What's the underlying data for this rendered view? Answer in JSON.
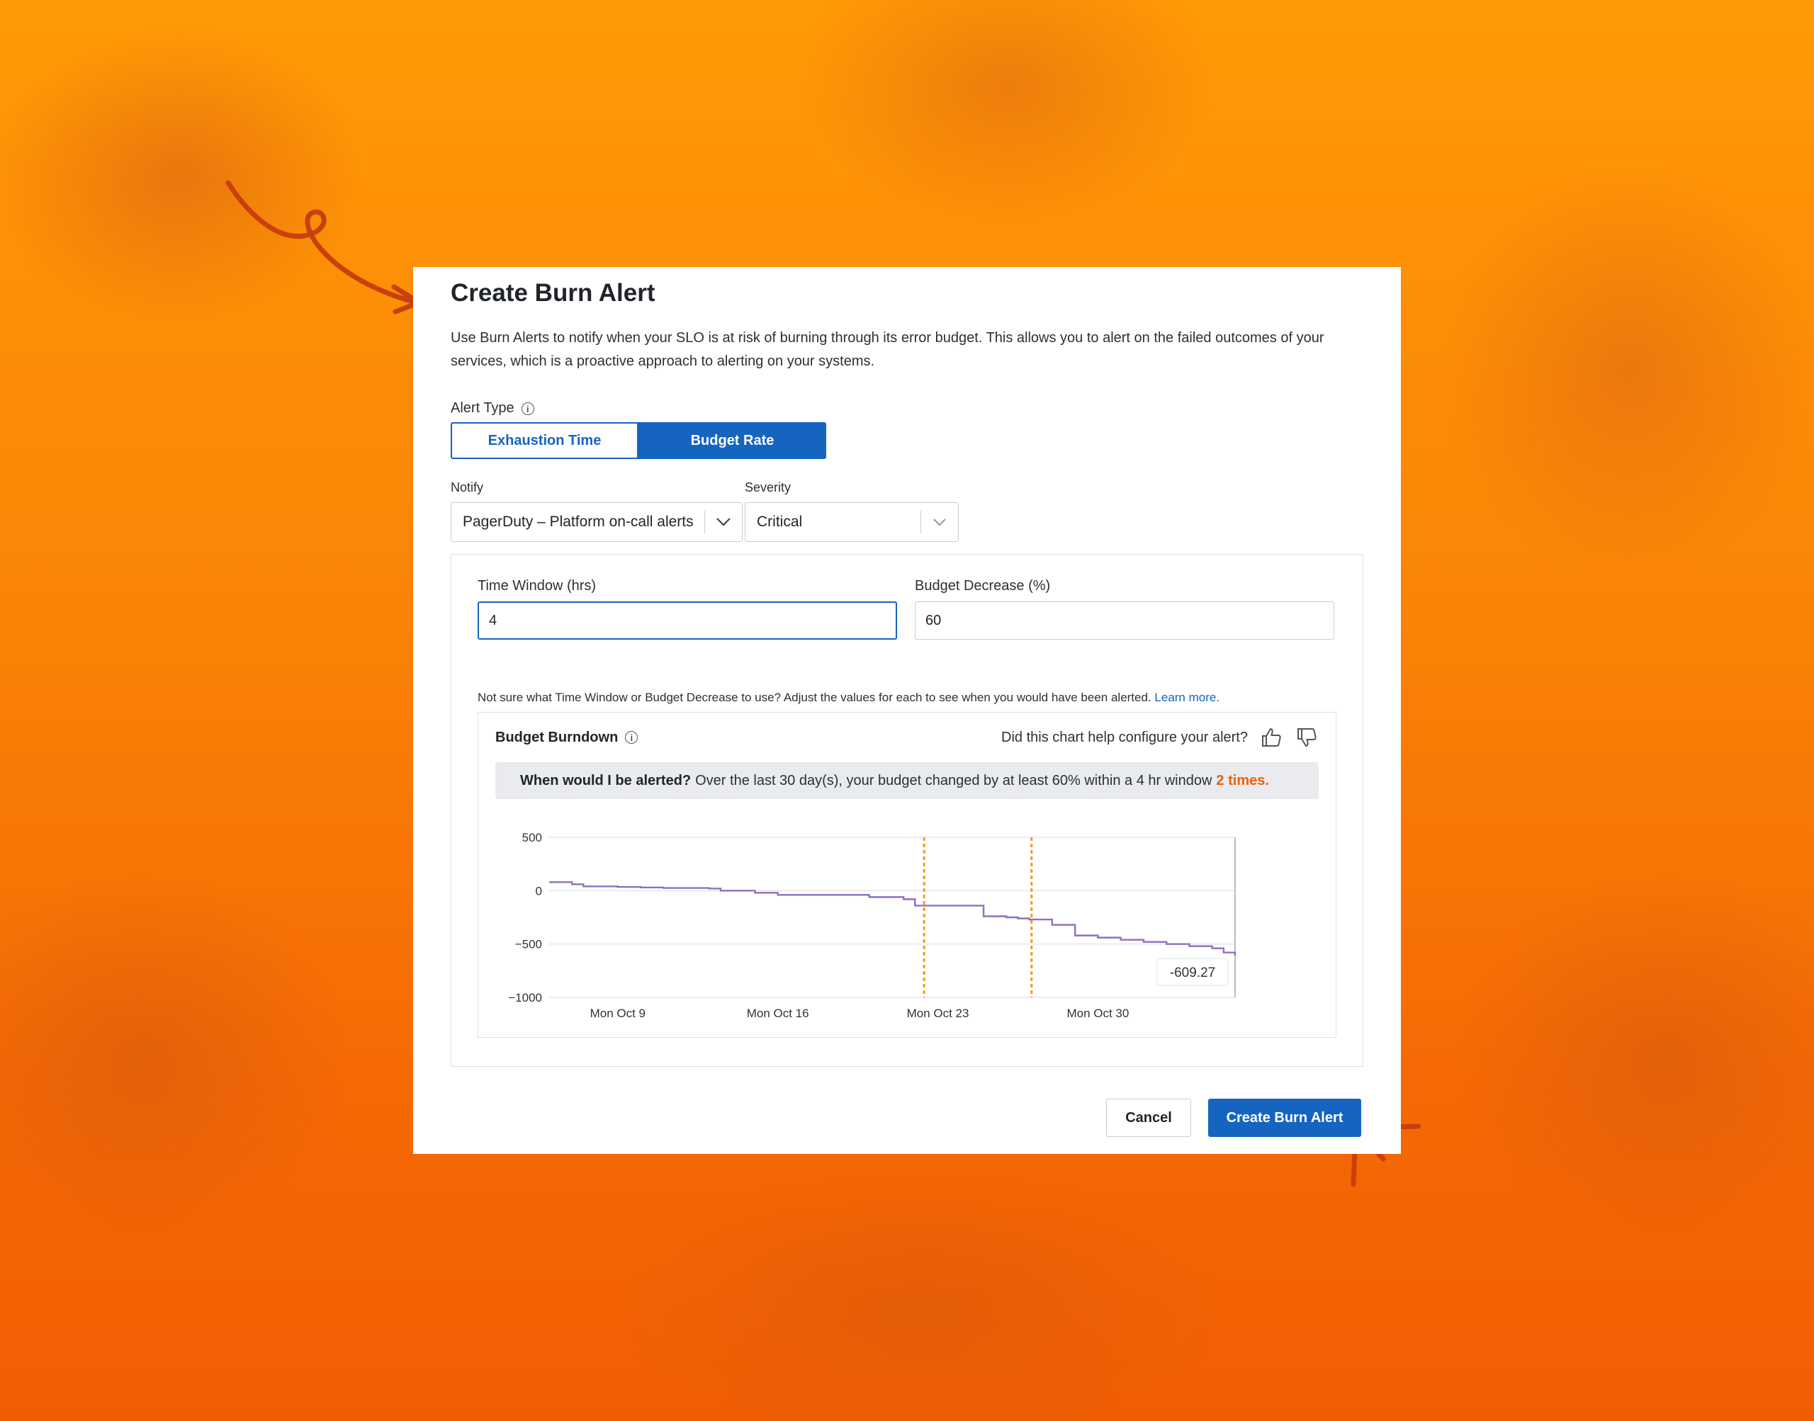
{
  "dialog": {
    "title": "Create Burn Alert",
    "description": "Use Burn Alerts to notify when your SLO is at risk of burning through its error budget. This allows you to alert on the failed outcomes of your services, which is a proactive approach to alerting on your systems."
  },
  "alert_type": {
    "label": "Alert Type",
    "options": [
      "Exhaustion Time",
      "Budget Rate"
    ],
    "selected": "Budget Rate"
  },
  "notify": {
    "label": "Notify",
    "value": "PagerDuty – Platform on-call alerts"
  },
  "severity": {
    "label": "Severity",
    "value": "Critical"
  },
  "time_window": {
    "label": "Time Window (hrs)",
    "value": "4"
  },
  "budget_decrease": {
    "label": "Budget Decrease (%)",
    "value": "60"
  },
  "hint": {
    "text": "Not sure what Time Window or Budget Decrease to use? Adjust the values for each to see when you would have been alerted.",
    "link": "Learn more."
  },
  "burndown": {
    "title": "Budget Burndown",
    "feedback_question": "Did this chart help configure your alert?",
    "banner_bold": "When would I be alerted?",
    "banner_text": "Over the last 30 day(s), your budget changed by at least 60% within a 4 hr window",
    "banner_times": "2 times."
  },
  "chart_data": {
    "type": "line",
    "y_ticks": [
      "500",
      "0",
      "−500",
      "−1000"
    ],
    "ylim": [
      -1000,
      500
    ],
    "x_ticks": [
      "Mon Oct 9",
      "Mon Oct 16",
      "Mon Oct 23",
      "Mon Oct 30"
    ],
    "x_start_day": 6,
    "x_end_day": 36,
    "series": [
      {
        "x": [
          6,
          7,
          7.5,
          9,
          10,
          11,
          13,
          13.5,
          15,
          16,
          18,
          19.5,
          20,
          21.5,
          22,
          24,
          25,
          25.5,
          26,
          26.5,
          27,
          28,
          29,
          30,
          31,
          32,
          33,
          34,
          35,
          35.5,
          36
        ],
        "y": [
          80,
          60,
          40,
          35,
          30,
          25,
          20,
          0,
          -20,
          -40,
          -40,
          -40,
          -60,
          -80,
          -140,
          -140,
          -240,
          -240,
          -250,
          -260,
          -270,
          -320,
          -420,
          -440,
          -460,
          -480,
          -500,
          -520,
          -540,
          -580,
          -609.27
        ]
      }
    ],
    "alert_markers_x": [
      22.4,
      27.1
    ],
    "annotation": "-609.27",
    "colors": {
      "line": "#8e6fc1",
      "marker": "#f39a1a",
      "grid": "#e3e5e8"
    }
  },
  "footer": {
    "cancel": "Cancel",
    "create": "Create Burn Alert"
  },
  "colors": {
    "primary": "#1565c0",
    "accent": "#e8620c"
  },
  "icons": [
    "info-icon",
    "chevron-down-icon",
    "thumbs-up-icon",
    "thumbs-down-icon"
  ]
}
